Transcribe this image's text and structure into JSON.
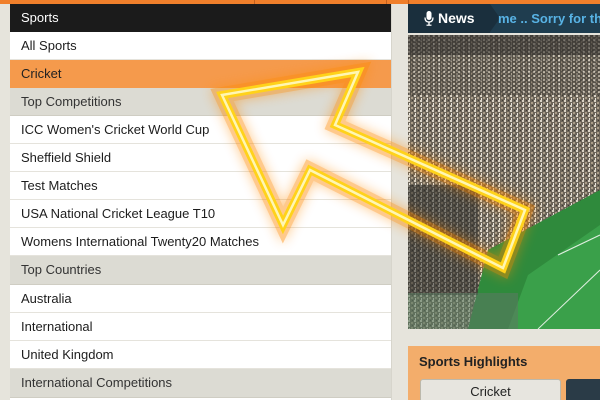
{
  "sports_menu": {
    "header": "Sports",
    "items": [
      {
        "label": "All Sports",
        "type": "link"
      },
      {
        "label": "Cricket",
        "type": "active"
      },
      {
        "label": "Top Competitions",
        "type": "section"
      },
      {
        "label": "ICC Women's Cricket World Cup",
        "type": "link"
      },
      {
        "label": "Sheffield Shield",
        "type": "link"
      },
      {
        "label": "Test Matches",
        "type": "link"
      },
      {
        "label": "USA National Cricket League T10",
        "type": "link"
      },
      {
        "label": "Womens International Twenty20 Matches",
        "type": "link"
      },
      {
        "label": "Top Countries",
        "type": "section"
      },
      {
        "label": "Australia",
        "type": "link"
      },
      {
        "label": "International",
        "type": "link"
      },
      {
        "label": "United Kingdom",
        "type": "link"
      },
      {
        "label": "International Competitions",
        "type": "section"
      }
    ]
  },
  "news": {
    "label": "News",
    "ticker": "me .. Sorry for th"
  },
  "highlights": {
    "title": "Sports Highlights",
    "tabs": [
      "Cricket"
    ]
  },
  "colors": {
    "brand_orange": "#f07f2b",
    "active_row": "#f59a4c",
    "section_row": "#dcdbd3",
    "arrow": "#ffd21a"
  },
  "icons": [
    "microphone-icon"
  ]
}
